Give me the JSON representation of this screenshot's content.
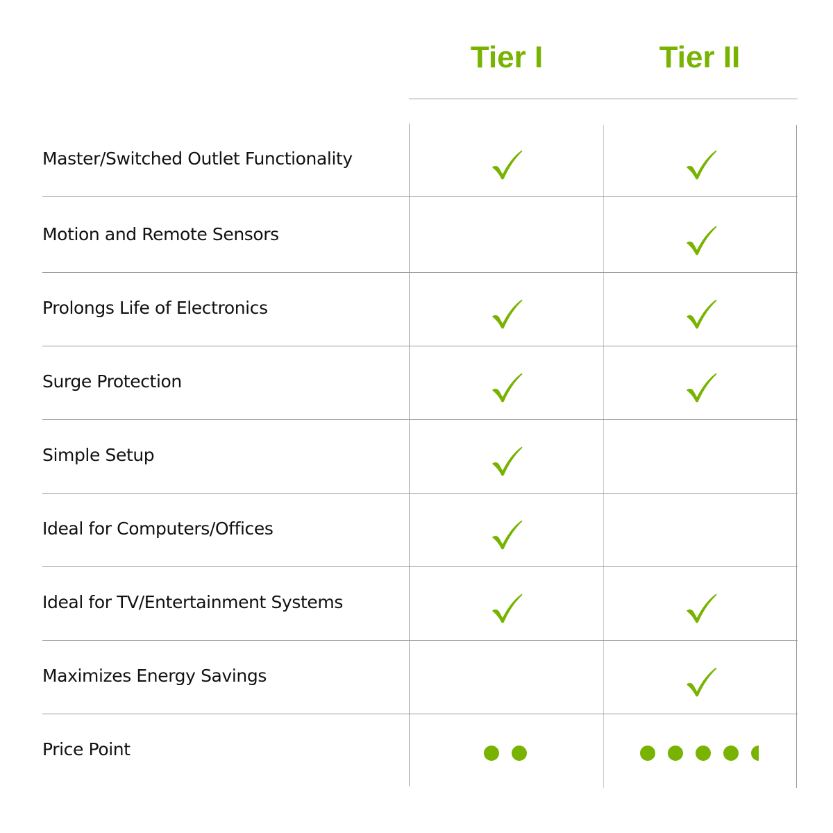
{
  "columns": [
    {
      "title": "Tier I"
    },
    {
      "title": "Tier II"
    }
  ],
  "accent_color": "#77b300",
  "rows": [
    {
      "feature": "Master/Switched Outlet Functionality",
      "tier1": true,
      "tier2": true
    },
    {
      "feature": "Motion and Remote Sensors",
      "tier1": false,
      "tier2": true
    },
    {
      "feature": "Prolongs Life of Electronics",
      "tier1": true,
      "tier2": true
    },
    {
      "feature": "Surge Protection",
      "tier1": true,
      "tier2": true
    },
    {
      "feature": "Simple Setup",
      "tier1": true,
      "tier2": false
    },
    {
      "feature": "Ideal for Computers/Offices",
      "tier1": true,
      "tier2": false
    },
    {
      "feature": "Ideal for TV/Entertainment Systems",
      "tier1": true,
      "tier2": true
    },
    {
      "feature": "Maximizes Energy Savings",
      "tier1": false,
      "tier2": true
    }
  ],
  "price_row": {
    "feature": "Price Point",
    "tier1_rating": 2,
    "tier2_rating": 4.5,
    "icon": "dot-icon"
  }
}
